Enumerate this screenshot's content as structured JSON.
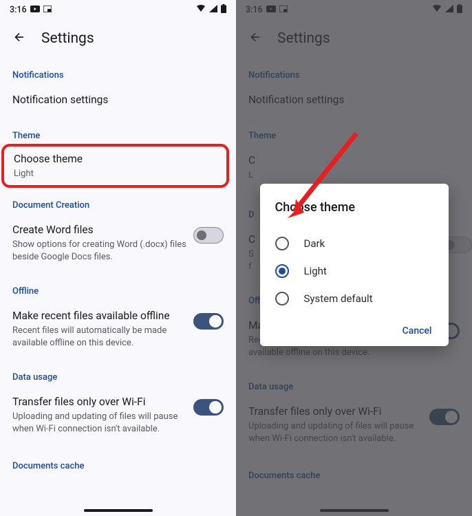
{
  "status": {
    "time": "3:16",
    "icons_left": [
      "youtube",
      "pip-window"
    ],
    "icons_right": [
      "wifi",
      "signal",
      "battery"
    ]
  },
  "header": {
    "title": "Settings"
  },
  "sections": {
    "notifications": {
      "header": "Notifications",
      "item_title": "Notification settings"
    },
    "theme": {
      "header": "Theme",
      "item_title": "Choose theme",
      "item_sub": "Light"
    },
    "doc_creation": {
      "header": "Document Creation",
      "item_title": "Create Word files",
      "item_sub": "Show options for creating Word (.docx) files beside Google Docs files.",
      "toggle": false
    },
    "offline": {
      "header": "Offline",
      "item_title": "Make recent files available offline",
      "item_sub": "Recent files will automatically be made available offline on this device.",
      "toggle": true
    },
    "data_usage": {
      "header": "Data usage",
      "item_title": "Transfer files only over Wi-Fi",
      "item_sub": "Uploading and updating of files will pause when Wi-Fi connection isn't available.",
      "toggle": true
    },
    "doc_cache": {
      "header": "Documents cache"
    }
  },
  "dialog": {
    "title": "Choose theme",
    "options": [
      "Dark",
      "Light",
      "System default"
    ],
    "selected_index": 1,
    "cancel": "Cancel"
  },
  "colors": {
    "accent": "#1a4ba0",
    "highlight": "#e62020",
    "toggle_on": "#3a537f"
  }
}
